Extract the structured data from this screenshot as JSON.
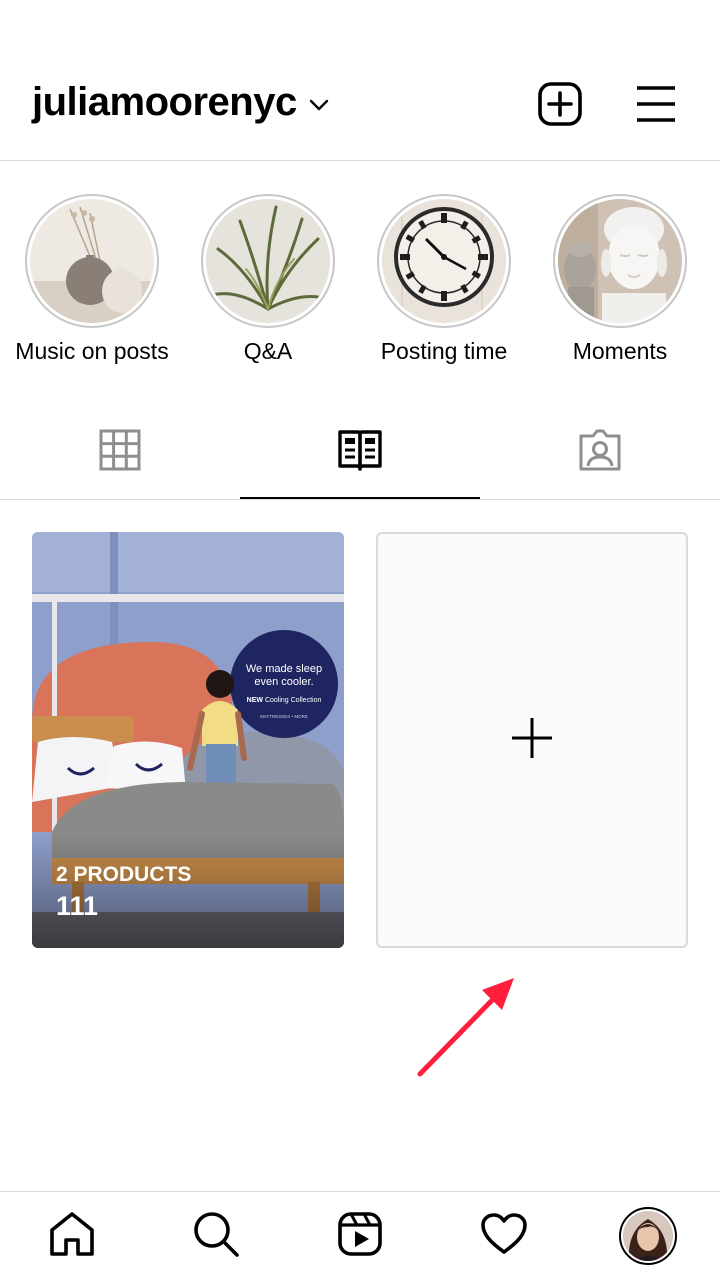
{
  "header": {
    "username": "juliamoorenyc",
    "dropdown_icon": "chevron-down-icon",
    "add_icon": "plus-square-icon",
    "menu_icon": "hamburger-menu-icon"
  },
  "highlights": [
    {
      "label": "Music on posts",
      "image": "vases-photo"
    },
    {
      "label": "Q&A",
      "image": "plant-photo"
    },
    {
      "label": "Posting time",
      "image": "clock-photo"
    },
    {
      "label": "Moments",
      "image": "buddha-photo"
    }
  ],
  "tabs": [
    {
      "name": "posts-grid",
      "icon": "grid-icon",
      "active": false
    },
    {
      "name": "guides",
      "icon": "guide-book-icon",
      "active": true
    },
    {
      "name": "tagged",
      "icon": "tagged-person-icon",
      "active": false
    }
  ],
  "guides": {
    "items": [
      {
        "products_label": "2 PRODUCTS",
        "count": "111",
        "image": "bedroom-mattress-photo",
        "sign_text": [
          "We made sleep",
          "even cooler.",
          "NEW",
          "Cooling Collection",
          "MATTRESSES • MORE"
        ]
      }
    ],
    "add_icon": "plus-icon"
  },
  "annotation": {
    "type": "red-arrow",
    "color": "#ff1f3d"
  },
  "bottom_nav": [
    {
      "name": "home",
      "icon": "home-icon"
    },
    {
      "name": "search",
      "icon": "search-icon"
    },
    {
      "name": "reels",
      "icon": "reels-icon"
    },
    {
      "name": "activity",
      "icon": "heart-icon"
    },
    {
      "name": "profile",
      "icon": "avatar"
    }
  ],
  "colors": {
    "divider": "#dbdbdb",
    "ring": "#c7c7c7",
    "add_card_bg": "#fafafa",
    "arrow": "#ff1f3d"
  }
}
